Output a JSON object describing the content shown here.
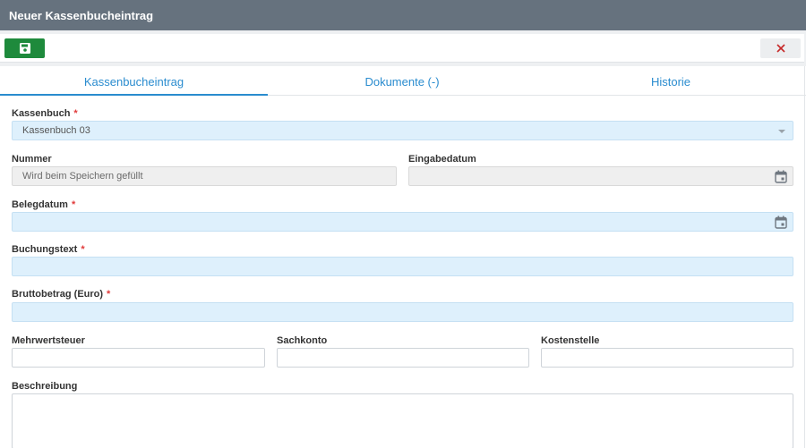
{
  "window": {
    "title": "Neuer Kassenbucheintrag"
  },
  "toolbar": {
    "save_icon": "save-icon",
    "close_icon": "close-icon",
    "close_color": "#c62828",
    "save_color": "#1e8a3c"
  },
  "tabs": [
    {
      "label": "Kassenbucheintrag",
      "active": true
    },
    {
      "label": "Dokumente (-)",
      "active": false
    },
    {
      "label": "Historie",
      "active": false
    }
  ],
  "form": {
    "kassenbuch": {
      "label": "Kassenbuch",
      "required_mark": "*",
      "value": "Kassenbuch 03"
    },
    "nummer": {
      "label": "Nummer",
      "placeholder": "Wird beim Speichern gefüllt"
    },
    "eingabedatum": {
      "label": "Eingabedatum",
      "value": ""
    },
    "belegdatum": {
      "label": "Belegdatum",
      "required_mark": "*",
      "value": ""
    },
    "buchungstext": {
      "label": "Buchungstext",
      "required_mark": "*",
      "value": ""
    },
    "bruttobetrag": {
      "label": "Bruttobetrag (Euro)",
      "required_mark": "*",
      "value": ""
    },
    "mehrwertsteuer": {
      "label": "Mehrwertsteuer",
      "value": ""
    },
    "sachkonto": {
      "label": "Sachkonto",
      "value": ""
    },
    "kostenstelle": {
      "label": "Kostenstelle",
      "value": ""
    },
    "beschreibung": {
      "label": "Beschreibung",
      "value": ""
    }
  },
  "colors": {
    "accent": "#2a8ccf",
    "header": "#66727e",
    "required": "#e13b3b",
    "input_blue": "#def0fc"
  }
}
